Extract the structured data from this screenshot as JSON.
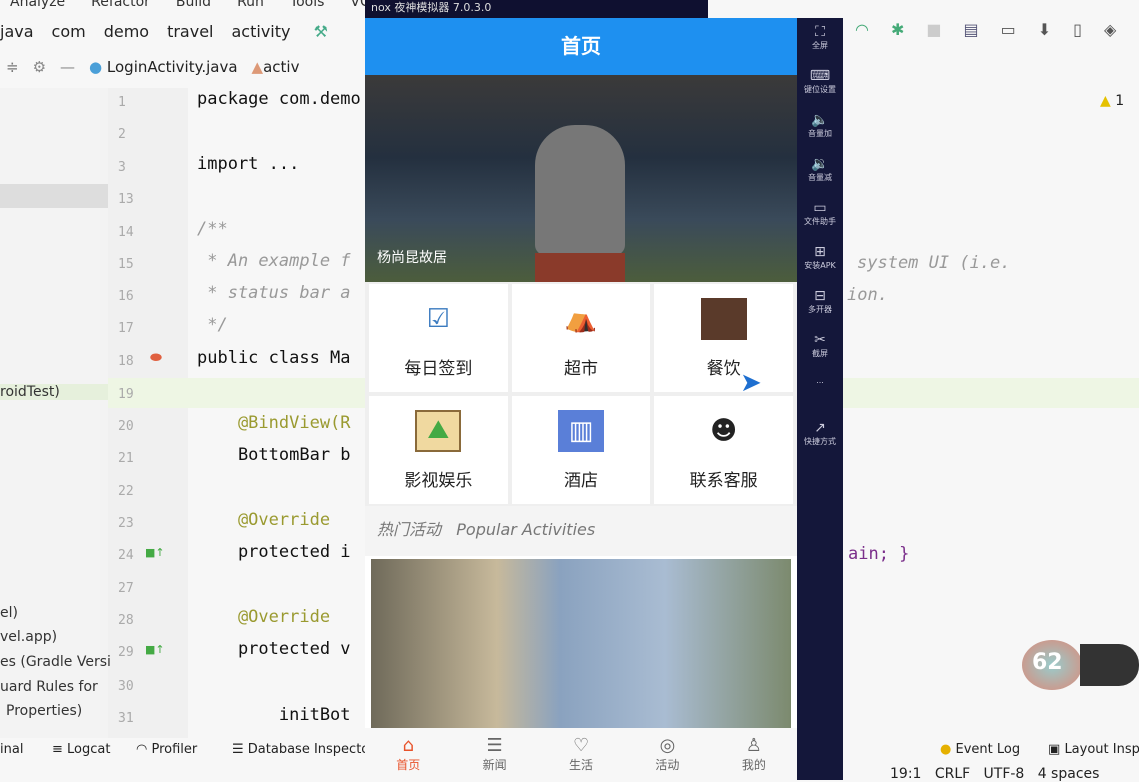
{
  "ide": {
    "menu": [
      "Analyze",
      "Refactor",
      "Build",
      "Run",
      "Tools",
      "VCS"
    ],
    "breadcrumbs": [
      "java",
      "com",
      "demo",
      "travel",
      "activity"
    ],
    "tabs": [
      {
        "label": "LoginActivity.java"
      },
      {
        "label": "activ"
      }
    ],
    "warnings": "1",
    "project_items": [
      "roidTest)",
      "el)",
      "vel.app)",
      "es (Gradle Versi",
      "uard Rules for",
      "Properties)"
    ],
    "line_numbers": [
      "1",
      "2",
      "3",
      "13",
      "14",
      "15",
      "16",
      "17",
      "18",
      "19",
      "20",
      "21",
      "22",
      "23",
      "24",
      "27",
      "28",
      "29",
      "30",
      "31"
    ],
    "code_lines": [
      "package com.demo",
      "",
      "import ...",
      "",
      "/**",
      " * An example f",
      " * status bar a",
      " */",
      "public class Ma",
      "",
      "    @BindView(R",
      "    BottomBar b",
      "",
      "    @Override",
      "    protected i",
      "",
      "    @Override",
      "    protected v",
      "",
      "        initBot"
    ],
    "code_right": {
      "line15": "system UI (i.e.",
      "line16": "ion.",
      "line24": "ain; }"
    },
    "bottom_tools": [
      "inal",
      "Logcat",
      "Profiler",
      "Database Inspecto"
    ],
    "bottom_right_tools": [
      "Event Log",
      "Layout Insp"
    ],
    "status": [
      "19:1",
      "CRLF",
      "UTF-8",
      "4 spaces"
    ],
    "widget_value": "62"
  },
  "emulator": {
    "title": "nox 夜神模拟器 7.0.3.0",
    "sidebar": [
      "全屏",
      "键位设置",
      "音量加",
      "音量减",
      "文件助手",
      "安装APK",
      "多开器",
      "截屏",
      "...",
      "快捷方式"
    ],
    "app": {
      "header": "首页",
      "banner_caption": "杨尚昆故居",
      "grid": [
        {
          "label": "每日签到",
          "icon": "checkin-icon"
        },
        {
          "label": "超市",
          "icon": "supermarket-icon"
        },
        {
          "label": "餐饮",
          "icon": "dining-icon"
        },
        {
          "label": "影视娱乐",
          "icon": "entertainment-icon"
        },
        {
          "label": "酒店",
          "icon": "hotel-icon"
        },
        {
          "label": "联系客服",
          "icon": "customer-service-icon"
        }
      ],
      "section_cn": "热门活动",
      "section_en": "Popular Activities",
      "nav": [
        {
          "label": "首页",
          "active": true
        },
        {
          "label": "新闻"
        },
        {
          "label": "生活"
        },
        {
          "label": "活动"
        },
        {
          "label": "我的"
        }
      ],
      "accent": "#1e90f0"
    }
  }
}
